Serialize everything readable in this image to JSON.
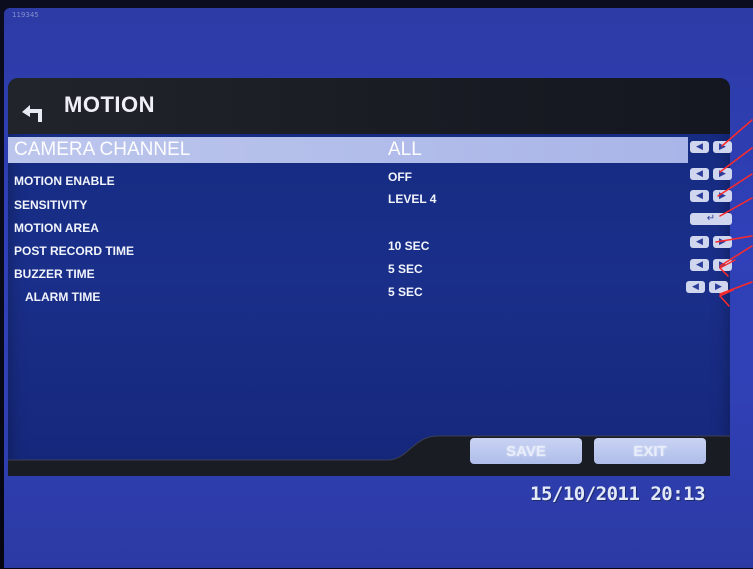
{
  "menu": {
    "title": "MOTION",
    "rows": [
      {
        "label": "CAMERA CHANNEL",
        "value": "ALL",
        "control": "arrows",
        "selected": true
      },
      {
        "label": "MOTION ENABLE",
        "value": "OFF",
        "control": "arrows",
        "selected": false
      },
      {
        "label": "SENSITIVITY",
        "value": "LEVEL 4",
        "control": "arrows",
        "selected": false
      },
      {
        "label": "MOTION AREA",
        "value": "",
        "control": "enter",
        "selected": false
      },
      {
        "label": "POST RECORD TIME",
        "value": "10 SEC",
        "control": "arrows",
        "selected": false
      },
      {
        "label": "BUZZER TIME",
        "value": "5 SEC",
        "control": "arrows",
        "selected": false
      },
      {
        "label": "ALARM TIME",
        "value": "5 SEC",
        "control": "arrows",
        "selected": false
      }
    ]
  },
  "buttons": {
    "save": "SAVE",
    "exit": "EXIT"
  },
  "status": {
    "timestamp": "15/10/2011 20:13",
    "camera_id": "119345"
  },
  "icons": {
    "title": "back-arrow-icon",
    "left": "left-arrow-icon",
    "right": "right-arrow-icon",
    "enter": "enter-icon"
  },
  "colors": {
    "screen_blue": "#2f40b8",
    "panel_blue": "#1a2f8a",
    "highlight": "#b3bfeb",
    "title_bar": "#1d1f28",
    "annotation_red": "#ff2a2a"
  }
}
